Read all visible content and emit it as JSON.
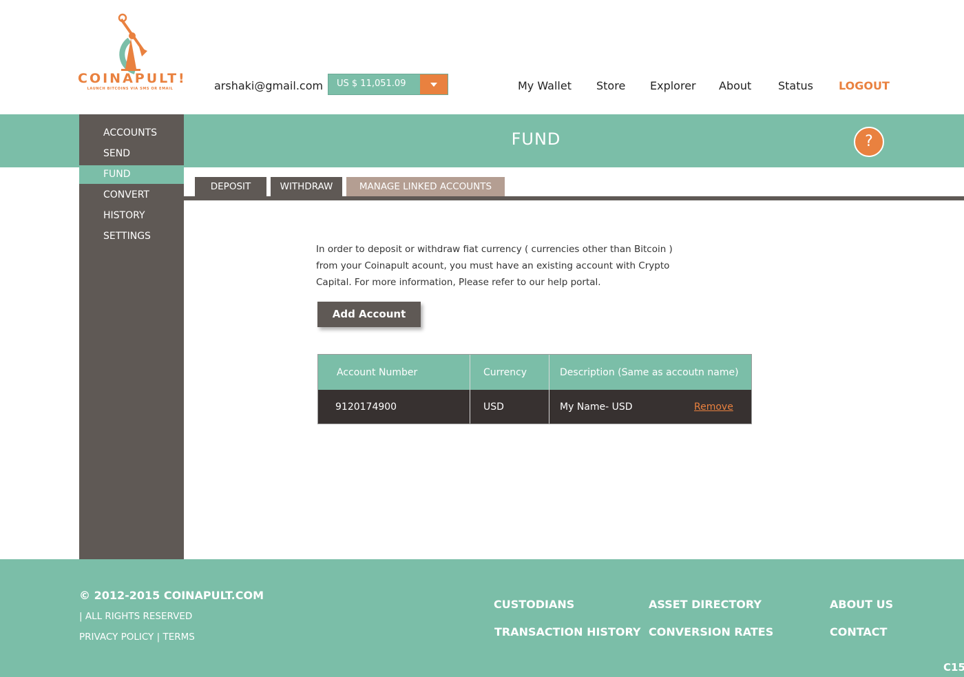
{
  "brand": {
    "name": "COINAPULT!",
    "tagline": "LAUNCH BITCOINS VIA SMS OR EMAIL"
  },
  "header": {
    "email": "arshaki@gmail.com",
    "balance": "US $ 11,051.09",
    "nav": [
      "My Wallet",
      "Store",
      "Explorer",
      "About",
      "Status"
    ],
    "logout": "LOGOUT"
  },
  "banner": {
    "title": "FUND",
    "help": "?"
  },
  "sidebar": {
    "items": [
      "ACCOUNTS",
      "SEND",
      "FUND",
      "CONVERT",
      "HISTORY",
      "SETTINGS"
    ],
    "active": "FUND"
  },
  "tabs": [
    "DEPOSIT",
    "WITHDRAW",
    "MANAGE LINKED ACCOUNTS"
  ],
  "content": {
    "lines": [
      "In order to deposit or withdraw fiat currency ( currencies other than Bitcoin )",
      "from your Coinapult acount, you must have an existing account with Crypto",
      "Capital. For more information, Please refer to our help portal."
    ],
    "add_button": "Add Account"
  },
  "table": {
    "headers": [
      "Account Number",
      "Currency",
      "Description  (Same as accoutn name)"
    ],
    "rows": [
      {
        "account": "9120174900",
        "currency": "USD",
        "description": "My Name- USD",
        "action": "Remove"
      }
    ]
  },
  "footer": {
    "copyright": "© 2012-2015 COINAPULT.COM",
    "rights": "| ALL RIGHTS RESERVED",
    "privacy": "PRIVACY POLICY",
    "separator": "|",
    "terms": "TERMS",
    "links": [
      "CUSTODIANS",
      "TRANSACTION HISTORY",
      "ASSET DIRECTORY",
      "CONVERSION RATES",
      "ABOUT US",
      "CONTACT"
    ],
    "code": "C15"
  },
  "colors": {
    "teal": "#7bbea8",
    "dark": "#5f5955",
    "orange": "#e9813f",
    "row": "#373130",
    "tab_manage": "#b49e92"
  }
}
